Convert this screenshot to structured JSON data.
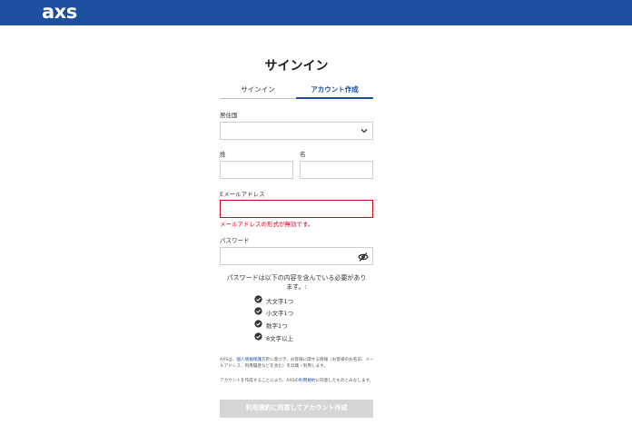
{
  "header": {
    "logo_text": "axs",
    "bg_color": "#1c4fa0"
  },
  "page": {
    "title": "サインイン"
  },
  "tabs": {
    "signin_label": "サインイン",
    "create_label": "アカウント作成",
    "active": "create"
  },
  "form": {
    "country": {
      "label": "居住国",
      "value": ""
    },
    "last_name": {
      "label": "姓",
      "value": ""
    },
    "first_name": {
      "label": "名",
      "value": ""
    },
    "email": {
      "label": "Eメールアドレス",
      "value": "",
      "error": "メールアドレスの形式が無効です。"
    },
    "password": {
      "label": "パスワード",
      "value": ""
    }
  },
  "password_rules": {
    "title": "パスワードは以下の内容を含んでいる必要があります。:",
    "items": [
      "大文字1つ",
      "小文字1つ",
      "数字1つ",
      "8文字以上"
    ]
  },
  "legal": {
    "p1_prefix": "AXSは、",
    "p1_link": "個人情報保護方針",
    "p1_suffix": "に基づき、お客様に関する情報（お客様のお名前、メールアドレス、利用履歴などを含む）を収集・利用します。",
    "p2_prefix": "アカウントを作成することにより、AXSの",
    "p2_link": "利用規約",
    "p2_suffix": "に同意したものとみなします。"
  },
  "submit_label": "利用規約に同意してアカウント作成",
  "colors": {
    "accent": "#1c4fa0",
    "error": "#d0021b",
    "disabled_button": "#d6d6d6"
  }
}
